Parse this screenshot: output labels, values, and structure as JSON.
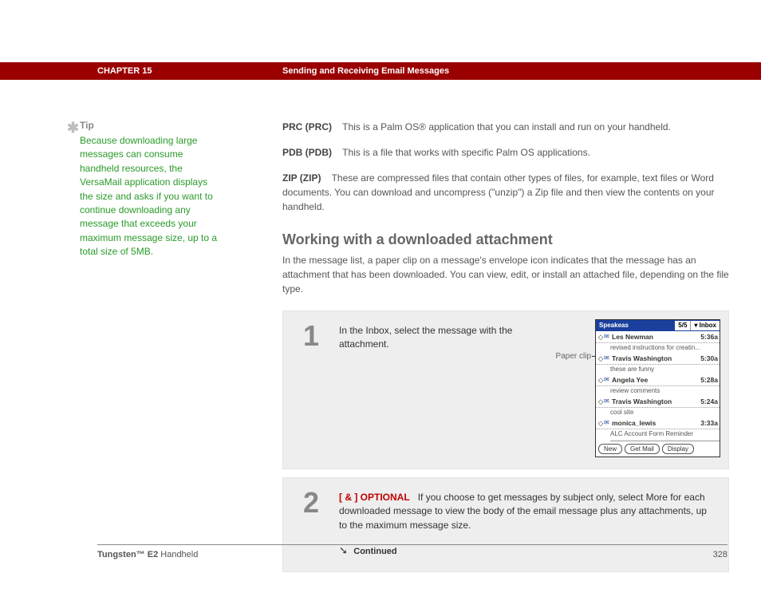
{
  "header": {
    "chapter": "CHAPTER 15",
    "title": "Sending and Receiving Email Messages"
  },
  "tip": {
    "label": "Tip",
    "text_before": "Because downloading large messages can consume ",
    "link": "handheld",
    "text_after": " resources, the VersaMail application displays the size and asks if you want to continue downloading any message that exceeds your maximum message size, up to a total size of 5MB."
  },
  "definitions": {
    "prc": {
      "term": "PRC (PRC)",
      "desc": "This is a Palm OS® application that you can install and run on your handheld."
    },
    "pdb": {
      "term": "PDB (PDB)",
      "desc": "This is a file that works with specific Palm OS applications."
    },
    "zip": {
      "term": "ZIP (ZIP)",
      "desc": "These are compressed files that contain other types of files, for example, text files or Word documents. You can download and uncompress (\"unzip\") a Zip file and then view the contents on your handheld."
    }
  },
  "section": {
    "heading": "Working with a downloaded attachment",
    "intro": "In the message list, a paper clip on a message's envelope icon indicates that the message has an attachment that has been downloaded. You can view, edit, or install an attached file, depending on the file type."
  },
  "steps": {
    "s1": {
      "num": "1",
      "text": "In the Inbox, select the message with the attachment."
    },
    "s2": {
      "num": "2",
      "optional_marker": "[ & ]  OPTIONAL",
      "text": "If you choose to get messages by subject only, select More for each downloaded message to view the body of the email message plus any attachments, up to the maximum message size.",
      "continued": "Continued"
    }
  },
  "paperclip_label": "Paper clip",
  "palm": {
    "app": "Speakeas",
    "count": "5/5",
    "folder": "Inbox",
    "rows": [
      {
        "name": "Les Newman",
        "time": "5:36a",
        "sub": "revised instructions for creatin...",
        "clip": true
      },
      {
        "name": "Travis Washington",
        "time": "5:30a",
        "sub": "these are funny",
        "clip": true
      },
      {
        "name": "Angela Yee",
        "time": "5:28a",
        "sub": "review comments",
        "clip": false
      },
      {
        "name": "Travis Washington",
        "time": "5:24a",
        "sub": "cool site",
        "clip": false
      },
      {
        "name": "monica_lewis",
        "time": "3:33a",
        "sub": "ALC Account Form Reminder",
        "clip": false
      }
    ],
    "buttons": {
      "new": "New",
      "get": "Get Mail",
      "display": "Display"
    }
  },
  "footer": {
    "product_bold": "Tungsten™ E2",
    "product_rest": " Handheld",
    "page": "328"
  }
}
